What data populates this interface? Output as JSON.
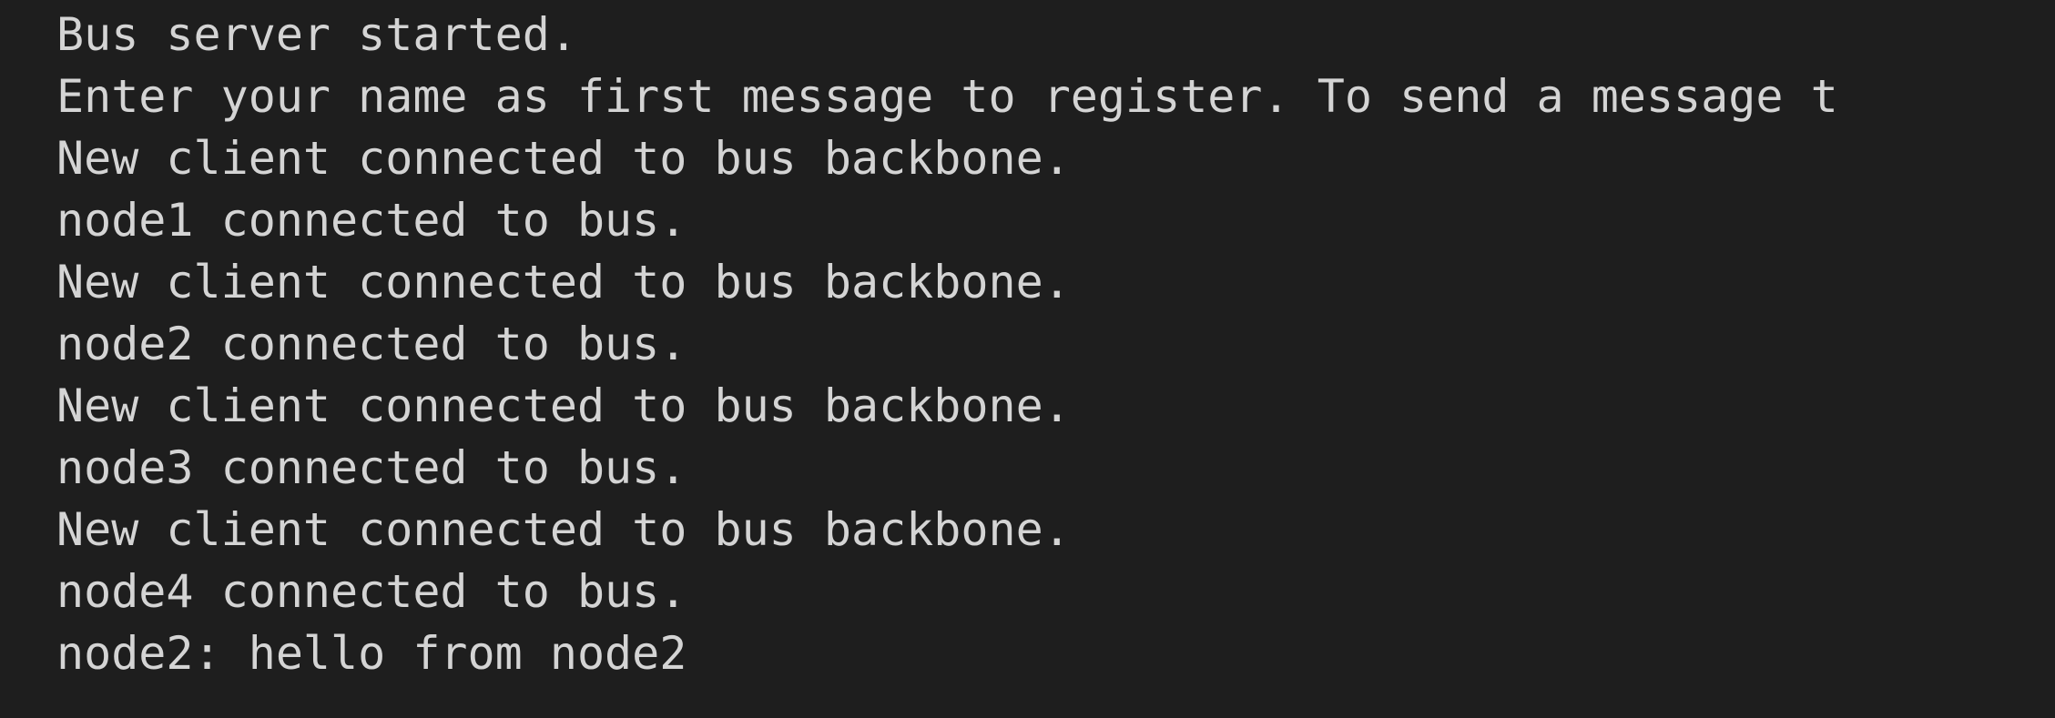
{
  "terminal": {
    "lines": [
      "Bus server started.",
      "Enter your name as first message to register. To send a message t",
      "New client connected to bus backbone.",
      "node1 connected to bus.",
      "New client connected to bus backbone.",
      "node2 connected to bus.",
      "New client connected to bus backbone.",
      "node3 connected to bus.",
      "New client connected to bus backbone.",
      "node4 connected to bus.",
      "node2: hello from node2"
    ],
    "colors": {
      "background": "#1e1e1e",
      "text": "#d4d4d4"
    }
  }
}
